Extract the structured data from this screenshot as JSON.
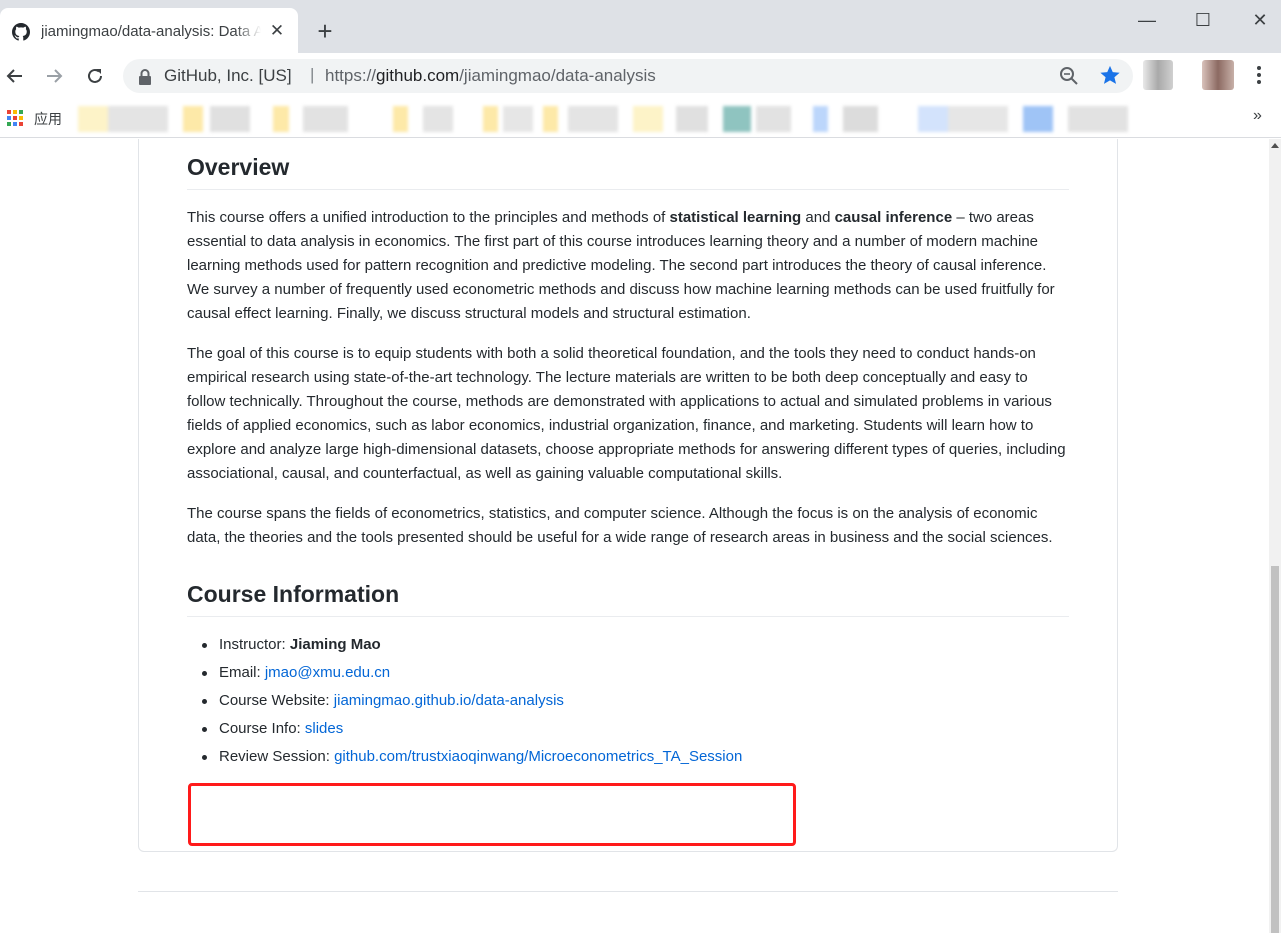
{
  "browser": {
    "tab_title": "jiamingmao/data-analysis: Data Analysis",
    "new_tab_symbol": "+",
    "close_symbol": "✕",
    "window_controls": {
      "minimize": "—",
      "maximize": "☐",
      "close": "✕"
    },
    "site_identity": "GitHub, Inc. [US]",
    "site_separator": "|",
    "url_scheme": "https://",
    "url_host": "github.com",
    "url_path": "/jiamingmao/data-analysis",
    "bookmarks_apps_label": "应用",
    "bookmarks_overflow": "»",
    "accent_color": "#1a73e8"
  },
  "readme": {
    "overview_heading": "Overview",
    "p1": {
      "t1": "This course offers a unified introduction to the principles and methods of ",
      "b1": "statistical learning",
      "t2": " and ",
      "b2": "causal inference",
      "t3": " – two areas essential to data analysis in economics. The first part of this course introduces learning theory and a number of modern machine learning methods used for pattern recognition and predictive modeling. The second part introduces the theory of causal inference. We survey a number of frequently used econometric methods and discuss how machine learning methods can be used fruitfully for causal effect learning. Finally, we discuss structural models and structural estimation."
    },
    "p2": "The goal of this course is to equip students with both a solid theoretical foundation, and the tools they need to conduct hands-on empirical research using state-of-the-art technology. The lecture materials are written to be both deep conceptually and easy to follow technically. Throughout the course, methods are demonstrated with applications to actual and simulated problems in various fields of applied economics, such as labor economics, industrial organization, finance, and marketing. Students will learn how to explore and analyze large high-dimensional datasets, choose appropriate methods for answering different types of queries, including associational, causal, and counterfactual, as well as gaining valuable computational skills.",
    "p3": "The course spans the fields of econometrics, statistics, and computer science. Although the focus is on the analysis of economic data, the theories and the tools presented should be useful for a wide range of research areas in business and the social sciences.",
    "course_heading": "Course Information",
    "info": {
      "instructor_label": "Instructor: ",
      "instructor_name": "Jiaming Mao",
      "email_label": "Email: ",
      "email_link": "jmao@xmu.edu.cn",
      "website_label": "Course Website: ",
      "website_link": "jiamingmao.github.io/data-analysis",
      "courseinfo_label": "Course Info: ",
      "courseinfo_link": "slides",
      "review_label": "Review Session: ",
      "review_link": "github.com/trustxiaoqinwang/Microeconometrics_TA_Session"
    },
    "link_color": "#0366d6",
    "highlight_color": "#ff1a1a"
  }
}
